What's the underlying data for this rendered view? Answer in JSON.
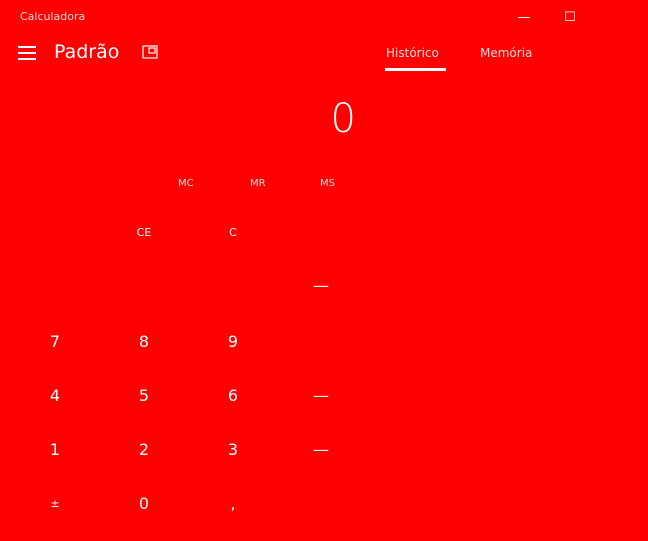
{
  "window": {
    "title": "Calculadora",
    "min_glyph": "—",
    "max_glyph": "☐"
  },
  "header": {
    "mode_title": "Padrão",
    "tabs": [
      "Histórico",
      "Memória"
    ]
  },
  "display": {
    "value": "0"
  },
  "memory": {
    "buttons": [
      "MC",
      "MR",
      "MS"
    ]
  },
  "keypad": {
    "row1": [
      "CE",
      "C"
    ],
    "row2": [
      "—"
    ],
    "row3": [
      "7",
      "8",
      "9"
    ],
    "row4": [
      "4",
      "5",
      "6",
      "—"
    ],
    "row5": [
      "1",
      "2",
      "3",
      "—"
    ],
    "row6": [
      "±",
      "0",
      ","
    ]
  }
}
